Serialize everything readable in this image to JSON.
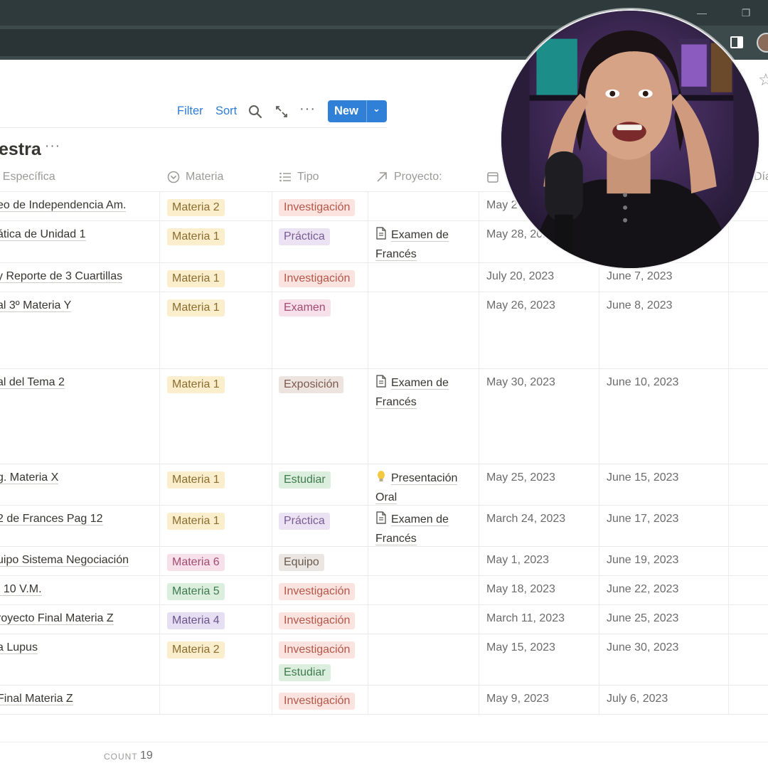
{
  "browser": {
    "window_controls": [
      "⌄",
      "—",
      "❐"
    ]
  },
  "view_toolbar": {
    "filter_label": "Filter",
    "sort_label": "Sort",
    "more_label": "···",
    "new_label": "New",
    "new_dropdown": "⌄"
  },
  "database": {
    "title": "estra",
    "more_label": "···"
  },
  "columns": {
    "name": "r Específica",
    "materia": "Materia",
    "tipo": "Tipo",
    "proyecto": "Proyecto:",
    "dias": "Día"
  },
  "rows": [
    {
      "name": "eo de Independencia Am.",
      "materia": "Materia 2",
      "materia_color": "#fbeecc",
      "tipos": [
        "Investigación"
      ],
      "proyecto": "",
      "proyecto_icon": "",
      "date1": "May 2",
      "date2": ""
    },
    {
      "name": "ática de Unidad 1",
      "materia": "Materia 1",
      "materia_color": "#fbeecc",
      "tipos": [
        "Práctica"
      ],
      "proyecto": "Examen de Francés",
      "proyecto_icon": "document-icon",
      "date1": "May 28, 202",
      "date2": ""
    },
    {
      "name": "y Reporte de 3 Cuartillas",
      "materia": "Materia 1",
      "materia_color": "#fbeecc",
      "tipos": [
        "Investigación"
      ],
      "proyecto": "",
      "proyecto_icon": "",
      "date1": "July 20, 2023",
      "date2": "June 7, 2023"
    },
    {
      "name": "al 3º Materia Y",
      "materia": "Materia 1",
      "materia_color": "#fbeecc",
      "tipos": [
        "Examen"
      ],
      "proyecto": "",
      "proyecto_icon": "",
      "date1": "May 26, 2023",
      "date2": "June 8, 2023"
    },
    {
      "name": "al del Tema 2",
      "materia": "Materia 1",
      "materia_color": "#fbeecc",
      "tipos": [
        "Exposición"
      ],
      "proyecto": "Examen de Francés",
      "proyecto_icon": "document-icon",
      "date1": "May 30, 2023",
      "date2": "June 10, 2023"
    },
    {
      "name": "g. Materia X",
      "materia": "Materia 1",
      "materia_color": "#fbeecc",
      "tipos": [
        "Estudiar"
      ],
      "proyecto": "Presentación Oral",
      "proyecto_icon": "lightbulb-icon",
      "date1": "May 25, 2023",
      "date2": "June 15, 2023"
    },
    {
      "name": "2 de Frances Pag 12",
      "materia": "Materia 1",
      "materia_color": "#fbeecc",
      "tipos": [
        "Práctica"
      ],
      "proyecto": "Examen de Francés",
      "proyecto_icon": "document-icon",
      "date1": "March 24, 2023",
      "date2": "June 17, 2023"
    },
    {
      "name": "uipo Sistema Negociación",
      "materia": "Materia 6",
      "materia_color": "#f8e0ea",
      "tipos": [
        "Equipo"
      ],
      "proyecto": "",
      "proyecto_icon": "",
      "date1": "May 1, 2023",
      "date2": "June 19, 2023"
    },
    {
      "name": ". 10 V.M.",
      "materia": "Materia 5",
      "materia_color": "#dcefdf",
      "tipos": [
        "Investigación"
      ],
      "proyecto": "",
      "proyecto_icon": "",
      "date1": "May 18, 2023",
      "date2": "June 22, 2023"
    },
    {
      "name": "royecto Final Materia Z",
      "materia": "Materia 4",
      "materia_color": "#e6def3",
      "tipos": [
        "Investigación"
      ],
      "proyecto": "",
      "proyecto_icon": "",
      "date1": "March 11, 2023",
      "date2": "June 25, 2023"
    },
    {
      "name": "a Lupus",
      "materia": "Materia 2",
      "materia_color": "#fbeecc",
      "tipos": [
        "Investigación",
        "Estudiar"
      ],
      "proyecto": "",
      "proyecto_icon": "",
      "date1": "May 15, 2023",
      "date2": "June 30, 2023"
    },
    {
      "name": "Final Materia Z",
      "materia": "",
      "materia_color": "",
      "tipos": [
        "Investigación"
      ],
      "proyecto": "",
      "proyecto_icon": "",
      "date1": "May 9, 2023",
      "date2": "July 6, 2023"
    }
  ],
  "tipo_colors": {
    "Investigación": {
      "bg": "#fbe4e0",
      "fg": "#b4574a"
    },
    "Práctica": {
      "bg": "#ebe2f3",
      "fg": "#7a5c93"
    },
    "Examen": {
      "bg": "#f8e0ea",
      "fg": "#a14b71"
    },
    "Exposición": {
      "bg": "#ede3df",
      "fg": "#7c5a4f"
    },
    "Estudiar": {
      "bg": "#dcefdf",
      "fg": "#3f7a4c"
    },
    "Equipo": {
      "bg": "#ebe6e2",
      "fg": "#6a5a50"
    }
  },
  "footer": {
    "count_label": "COUNT",
    "count_value": "19"
  }
}
